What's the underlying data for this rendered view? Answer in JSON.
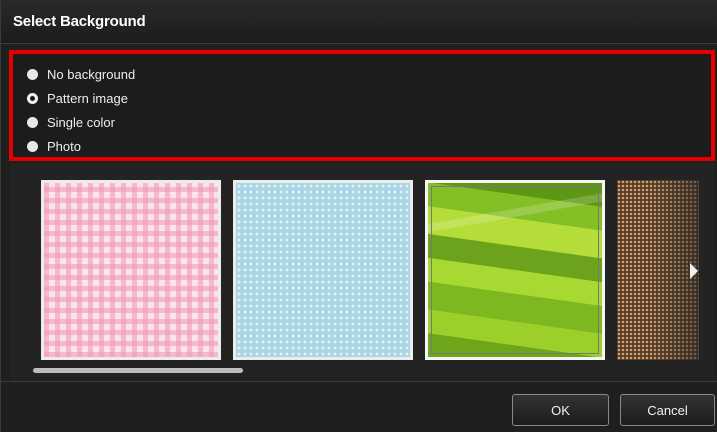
{
  "dialog": {
    "title": "Select Background"
  },
  "options": [
    {
      "label": "No background",
      "selected": false
    },
    {
      "label": "Pattern image",
      "selected": true
    },
    {
      "label": "Single color",
      "selected": false
    },
    {
      "label": "Photo",
      "selected": false
    }
  ],
  "gallery": {
    "items": [
      "pink-gingham-pattern",
      "blue-dot-pattern",
      "green-wave-pattern",
      "brown-dot-pattern"
    ],
    "selected_index": 2,
    "next_icon": "chevron-right-icon"
  },
  "buttons": {
    "ok_label": "OK",
    "cancel_label": "Cancel"
  },
  "colors": {
    "highlight": "#e60000",
    "background": "#1f1f1f"
  }
}
